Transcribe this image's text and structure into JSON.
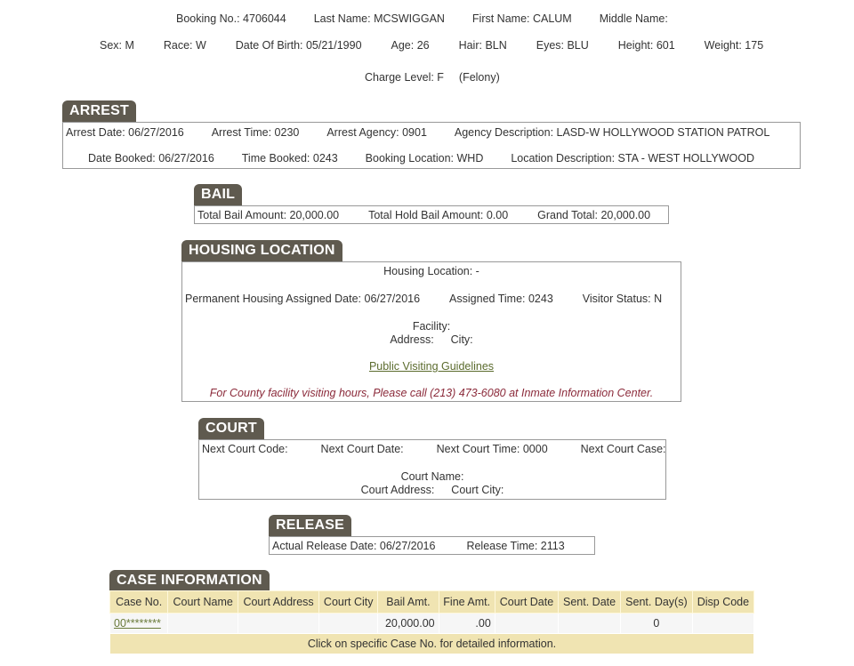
{
  "header": {
    "booking_no": "Booking No.: 4706044",
    "last_name": "Last Name: MCSWIGGAN",
    "first_name": "First Name: CALUM",
    "middle_name": "Middle Name:",
    "sex": "Sex: M",
    "race": "Race: W",
    "dob": "Date Of Birth: 05/21/1990",
    "age": "Age: 26",
    "hair": "Hair: BLN",
    "eyes": "Eyes: BLU",
    "height": "Height: 601",
    "weight": "Weight: 175",
    "charge_level": "Charge Level: F",
    "charge_desc": "(Felony)"
  },
  "arrest": {
    "title": "ARREST",
    "arrest_date": "Arrest Date: 06/27/2016",
    "arrest_time": "Arrest Time: 0230",
    "arrest_agency": "Arrest Agency: 0901",
    "agency_description": "Agency Description: LASD-W HOLLYWOOD STATION PATROL",
    "date_booked": "Date Booked: 06/27/2016",
    "time_booked": "Time Booked: 0243",
    "booking_location": "Booking Location: WHD",
    "location_description": "Location Description: STA - WEST HOLLYWOOD"
  },
  "bail": {
    "title": "BAIL",
    "total_bail": "Total Bail Amount: 20,000.00",
    "total_hold_bail": "Total Hold Bail Amount: 0.00",
    "grand_total": "Grand Total: 20,000.00"
  },
  "housing": {
    "title": "HOUSING LOCATION",
    "housing_location": "Housing Location: -",
    "assigned_date": "Permanent Housing Assigned Date: 06/27/2016",
    "assigned_time": "Assigned Time: 0243",
    "visitor_status": "Visitor Status: N",
    "facility": "Facility:",
    "address": "Address:",
    "city": "City:",
    "guidelines_link": "Public Visiting Guidelines",
    "note": "For County facility visiting hours, Please call (213) 473-6080 at Inmate Information Center."
  },
  "court": {
    "title": "COURT",
    "next_court_code": "Next Court Code:",
    "next_court_date": "Next Court Date:",
    "next_court_time": "Next Court Time: 0000",
    "next_court_case": "Next Court Case:",
    "court_name": "Court Name:",
    "court_address": "Court Address:",
    "court_city": "Court City:"
  },
  "release": {
    "title": "RELEASE",
    "release_date": "Actual Release Date: 06/27/2016",
    "release_time": "Release Time: 2113"
  },
  "case_info": {
    "title": "CASE INFORMATION",
    "columns": [
      "Case No.",
      "Court Name",
      "Court Address",
      "Court City",
      "Bail Amt.",
      "Fine Amt.",
      "Court Date",
      "Sent. Date",
      "Sent. Day(s)",
      "Disp Code"
    ],
    "rows": [
      [
        "00********",
        "",
        "",
        "",
        "20,000.00",
        ".00",
        "",
        "",
        "0",
        ""
      ]
    ],
    "footer": "Click on specific Case No. for detailed information."
  }
}
